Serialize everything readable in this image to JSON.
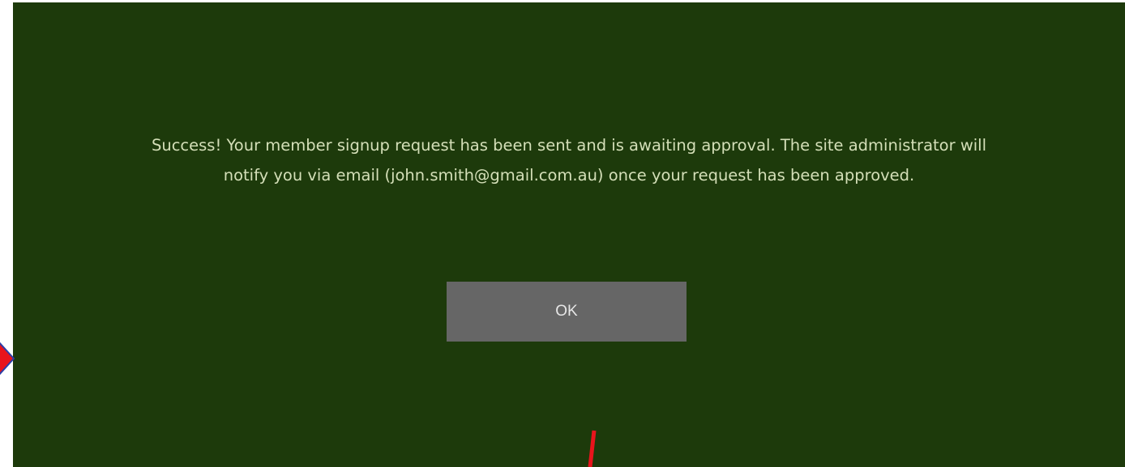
{
  "dialog": {
    "message": "Success! Your member signup request has been sent and is awaiting approval. The site administrator will notify you via email (john.smith@gmail.com.au) once your request has been approved.",
    "ok_label": "OK"
  },
  "colors": {
    "dialog_background": "#1d3a0b",
    "message_text": "#d4dfb8",
    "button_background": "#666666",
    "annotation_red": "#e8141c",
    "annotation_outline": "#2b3ea8"
  },
  "annotations": {
    "arrow_icon": "right-arrow-icon",
    "mark_icon": "red-line-mark-icon"
  }
}
